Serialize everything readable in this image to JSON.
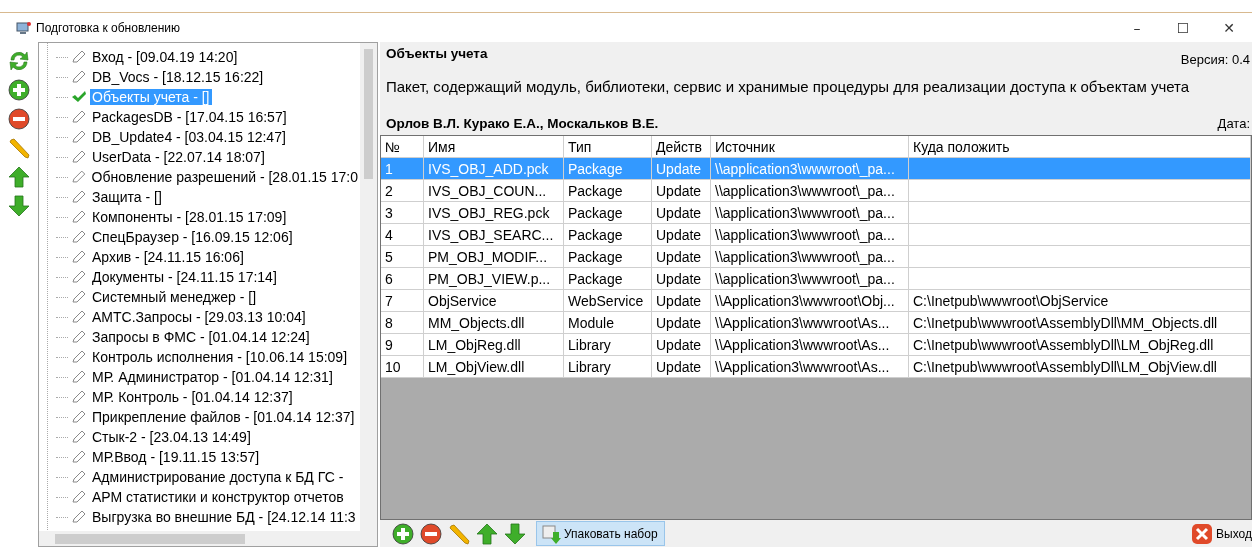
{
  "window": {
    "title": "Подготовка к обновлению",
    "controls": [
      "–",
      "☐",
      "✕"
    ]
  },
  "tree": {
    "items": [
      {
        "label": "Вход - [09.04.19 14:20]",
        "kind": "edit",
        "selected": false
      },
      {
        "label": "DB_Vocs - [18.12.15 16:22]",
        "kind": "edit",
        "selected": false
      },
      {
        "label": "Объекты учета - []",
        "kind": "done",
        "selected": true
      },
      {
        "label": "PackagesDB - [17.04.15 16:57]",
        "kind": "edit",
        "selected": false
      },
      {
        "label": "DB_Update4 - [03.04.15 12:47]",
        "kind": "edit",
        "selected": false
      },
      {
        "label": "UserData - [22.07.14 18:07]",
        "kind": "edit",
        "selected": false
      },
      {
        "label": "Обновление разрешений - [28.01.15 17:0",
        "kind": "edit",
        "selected": false
      },
      {
        "label": "Защита - []",
        "kind": "edit",
        "selected": false
      },
      {
        "label": "Компоненты - [28.01.15 17:09]",
        "kind": "edit",
        "selected": false
      },
      {
        "label": "СпецБраузер - [16.09.15 12:06]",
        "kind": "edit",
        "selected": false
      },
      {
        "label": "Архив - [24.11.15 16:06]",
        "kind": "edit",
        "selected": false
      },
      {
        "label": "Документы - [24.11.15 17:14]",
        "kind": "edit",
        "selected": false
      },
      {
        "label": "Системный менеджер - []",
        "kind": "edit",
        "selected": false
      },
      {
        "label": "АМТС.Запросы - [29.03.13 10:04]",
        "kind": "edit",
        "selected": false
      },
      {
        "label": "Запросы в ФМС - [01.04.14 12:24]",
        "kind": "edit",
        "selected": false
      },
      {
        "label": "Контроль исполнения - [10.06.14 15:09]",
        "kind": "edit",
        "selected": false
      },
      {
        "label": "МР. Администратор - [01.04.14 12:31]",
        "kind": "edit",
        "selected": false
      },
      {
        "label": "МР. Контроль - [01.04.14 12:37]",
        "kind": "edit",
        "selected": false
      },
      {
        "label": "Прикрепление файлов - [01.04.14 12:37]",
        "kind": "edit",
        "selected": false
      },
      {
        "label": "Стык-2 - [23.04.13 14:49]",
        "kind": "edit",
        "selected": false
      },
      {
        "label": "МР.Ввод - [19.11.15 13:57]",
        "kind": "edit",
        "selected": false
      },
      {
        "label": "Администрирование доступа к БД  ГС -",
        "kind": "edit",
        "selected": false
      },
      {
        "label": "АРМ статистики и конструктор отчетов",
        "kind": "edit",
        "selected": false
      },
      {
        "label": "Выгрузка во внешние БД - [24.12.14 11:3",
        "kind": "edit",
        "selected": false
      }
    ]
  },
  "details": {
    "name": "Объекты учета",
    "version": "Версия: 0.4",
    "description": "Пакет, содержащий  модуль, библиотеки, сервис и хранимые процедуры для реализации доступа к объектам учета",
    "authors": "Орлов В.Л. Курако Е.А., Москальков В.Е.",
    "date": "Дата:"
  },
  "table": {
    "columns": [
      "№",
      "Имя",
      "Тип",
      "Действ",
      "Источник",
      "Куда положить"
    ],
    "rows": [
      {
        "cells": [
          "1",
          "IVS_OBJ_ADD.pck",
          "Package",
          "Update",
          "\\\\application3\\wwwroot\\_pa...",
          ""
        ],
        "selected": true
      },
      {
        "cells": [
          "2",
          "IVS_OBJ_COUN...",
          "Package",
          "Update",
          "\\\\application3\\wwwroot\\_pa...",
          ""
        ],
        "selected": false
      },
      {
        "cells": [
          "3",
          "IVS_OBJ_REG.pck",
          "Package",
          "Update",
          "\\\\application3\\wwwroot\\_pa...",
          ""
        ],
        "selected": false
      },
      {
        "cells": [
          "4",
          "IVS_OBJ_SEARC...",
          "Package",
          "Update",
          "\\\\application3\\wwwroot\\_pa...",
          ""
        ],
        "selected": false
      },
      {
        "cells": [
          "5",
          "PM_OBJ_MODIF...",
          "Package",
          "Update",
          "\\\\application3\\wwwroot\\_pa...",
          ""
        ],
        "selected": false
      },
      {
        "cells": [
          "6",
          "PM_OBJ_VIEW.p...",
          "Package",
          "Update",
          "\\\\application3\\wwwroot\\_pa...",
          ""
        ],
        "selected": false
      },
      {
        "cells": [
          "7",
          "ObjService",
          "WebService",
          "Update",
          "\\\\Application3\\wwwroot\\Obj...",
          "C:\\Inetpub\\wwwroot\\ObjService"
        ],
        "selected": false
      },
      {
        "cells": [
          "8",
          "MM_Objects.dll",
          "Module",
          "Update",
          "\\\\Application3\\wwwroot\\As...",
          "C:\\Inetpub\\wwwroot\\AssemblyDll\\MM_Objects.dll"
        ],
        "selected": false
      },
      {
        "cells": [
          "9",
          "LM_ObjReg.dll",
          "Library",
          "Update",
          "\\\\Application3\\wwwroot\\As...",
          "C:\\Inetpub\\wwwroot\\AssemblyDll\\LM_ObjReg.dll"
        ],
        "selected": false
      },
      {
        "cells": [
          "10",
          "LM_ObjView.dll",
          "Library",
          "Update",
          "\\\\Application3\\wwwroot\\As...",
          "C:\\Inetpub\\wwwroot\\AssemblyDll\\LM_ObjView.dll"
        ],
        "selected": false
      }
    ]
  },
  "bottom_toolbar": {
    "pack_button": "Упаковать набор",
    "exit_button": "Выход"
  }
}
